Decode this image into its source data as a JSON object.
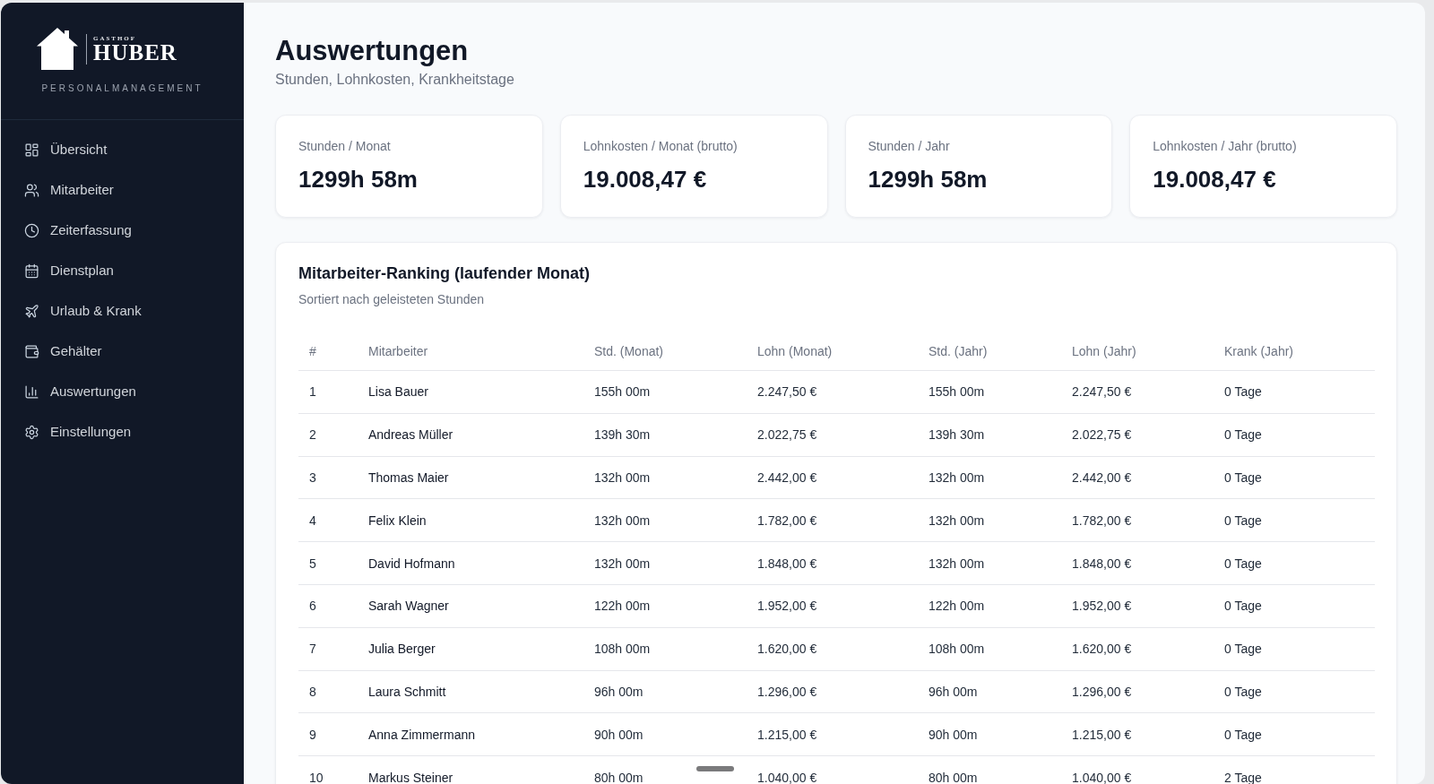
{
  "sidebar": {
    "brand": {
      "overline": "GASTHOF",
      "name": "HUBER",
      "tagline": "PERSONALMANAGEMENT"
    },
    "items": [
      {
        "label": "Übersicht"
      },
      {
        "label": "Mitarbeiter"
      },
      {
        "label": "Zeiterfassung"
      },
      {
        "label": "Dienstplan"
      },
      {
        "label": "Urlaub & Krank"
      },
      {
        "label": "Gehälter"
      },
      {
        "label": "Auswertungen"
      },
      {
        "label": "Einstellungen"
      }
    ]
  },
  "header": {
    "title": "Auswertungen",
    "subtitle": "Stunden, Lohnkosten, Krankheitstage"
  },
  "stats": [
    {
      "label": "Stunden / Monat",
      "value": "1299h 58m"
    },
    {
      "label": "Lohnkosten / Monat (brutto)",
      "value": "19.008,47 €"
    },
    {
      "label": "Stunden / Jahr",
      "value": "1299h 58m"
    },
    {
      "label": "Lohnkosten / Jahr (brutto)",
      "value": "19.008,47 €"
    }
  ],
  "ranking": {
    "title": "Mitarbeiter-Ranking (laufender Monat)",
    "subtitle": "Sortiert nach geleisteten Stunden",
    "table": {
      "columns": [
        "#",
        "Mitarbeiter",
        "Std. (Monat)",
        "Lohn (Monat)",
        "Std. (Jahr)",
        "Lohn (Jahr)",
        "Krank (Jahr)"
      ],
      "rows": [
        {
          "rank": "1",
          "name": "Lisa Bauer",
          "hours_month": "155h 00m",
          "wage_month": "2.247,50 €",
          "hours_year": "155h 00m",
          "wage_year": "2.247,50 €",
          "sick_year": "0 Tage"
        },
        {
          "rank": "2",
          "name": "Andreas Müller",
          "hours_month": "139h 30m",
          "wage_month": "2.022,75 €",
          "hours_year": "139h 30m",
          "wage_year": "2.022,75 €",
          "sick_year": "0 Tage"
        },
        {
          "rank": "3",
          "name": "Thomas Maier",
          "hours_month": "132h 00m",
          "wage_month": "2.442,00 €",
          "hours_year": "132h 00m",
          "wage_year": "2.442,00 €",
          "sick_year": "0 Tage"
        },
        {
          "rank": "4",
          "name": "Felix Klein",
          "hours_month": "132h 00m",
          "wage_month": "1.782,00 €",
          "hours_year": "132h 00m",
          "wage_year": "1.782,00 €",
          "sick_year": "0 Tage"
        },
        {
          "rank": "5",
          "name": "David Hofmann",
          "hours_month": "132h 00m",
          "wage_month": "1.848,00 €",
          "hours_year": "132h 00m",
          "wage_year": "1.848,00 €",
          "sick_year": "0 Tage"
        },
        {
          "rank": "6",
          "name": "Sarah Wagner",
          "hours_month": "122h 00m",
          "wage_month": "1.952,00 €",
          "hours_year": "122h 00m",
          "wage_year": "1.952,00 €",
          "sick_year": "0 Tage"
        },
        {
          "rank": "7",
          "name": "Julia Berger",
          "hours_month": "108h 00m",
          "wage_month": "1.620,00 €",
          "hours_year": "108h 00m",
          "wage_year": "1.620,00 €",
          "sick_year": "0 Tage"
        },
        {
          "rank": "8",
          "name": "Laura Schmitt",
          "hours_month": "96h 00m",
          "wage_month": "1.296,00 €",
          "hours_year": "96h 00m",
          "wage_year": "1.296,00 €",
          "sick_year": "0 Tage"
        },
        {
          "rank": "9",
          "name": "Anna Zimmermann",
          "hours_month": "90h 00m",
          "wage_month": "1.215,00 €",
          "hours_year": "90h 00m",
          "wage_year": "1.215,00 €",
          "sick_year": "0 Tage"
        },
        {
          "rank": "10",
          "name": "Markus Steiner",
          "hours_month": "80h 00m",
          "wage_month": "1.040,00 €",
          "hours_year": "80h 00m",
          "wage_year": "1.040,00 €",
          "sick_year": "2 Tage"
        }
      ]
    }
  }
}
